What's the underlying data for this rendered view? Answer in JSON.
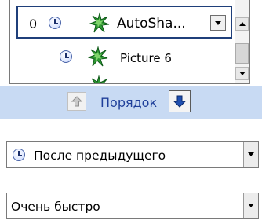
{
  "animation_list": {
    "items": [
      {
        "order": "0",
        "timing_icon": "clock-icon",
        "effect_icon": "star-burst-icon",
        "label": "AutoSha...",
        "selected": true
      },
      {
        "order": "",
        "timing_icon": "clock-icon",
        "effect_icon": "star-burst-icon",
        "label": "Picture 6",
        "selected": false
      },
      {
        "order": "",
        "timing_icon": "",
        "effect_icon": "star-burst-icon",
        "label": "",
        "selected": false
      }
    ]
  },
  "reorder": {
    "label": "Порядок",
    "up_icon": "arrow-up-icon",
    "down_icon": "arrow-down-icon"
  },
  "start": {
    "value": "После предыдущего",
    "icon": "clock-icon"
  },
  "speed": {
    "value": "Очень быстро"
  },
  "colors": {
    "band": "#c8daf3",
    "order_label": "#1f3f9a",
    "star_green": "#1f8a2a",
    "selection_border": "#1f3f7a"
  }
}
